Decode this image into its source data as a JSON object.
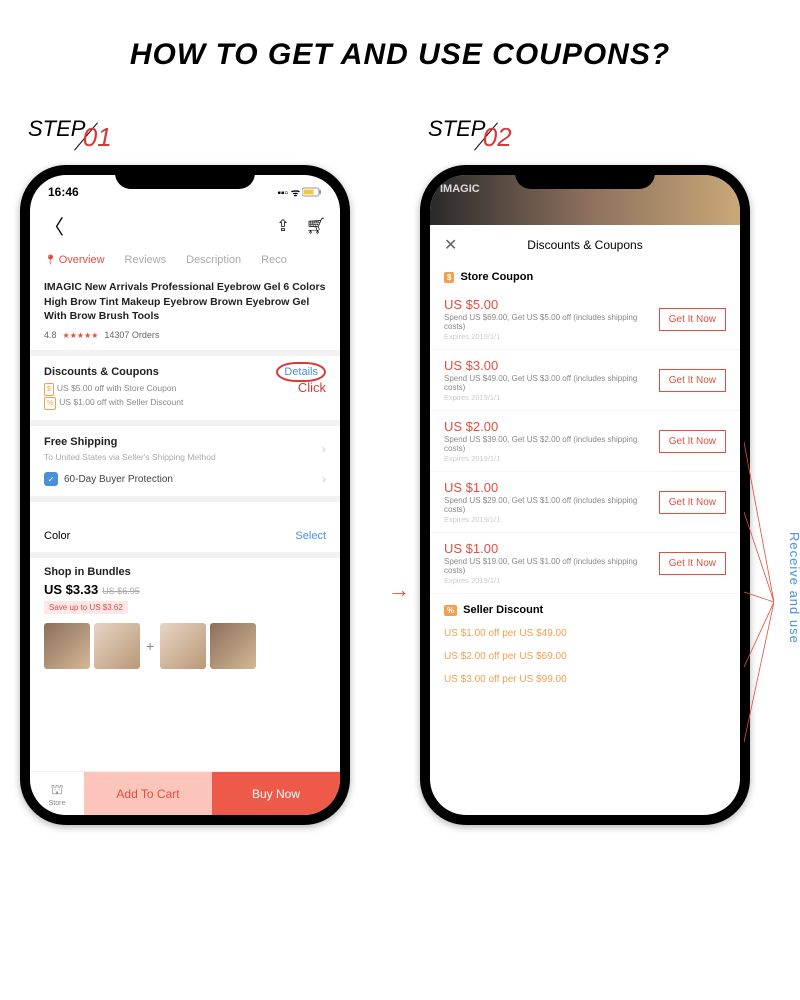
{
  "title": "HOW TO GET AND USE COUPONS?",
  "step1": {
    "label": "STEP",
    "num": "01"
  },
  "step2": {
    "label": "STEP",
    "num": "02"
  },
  "statusbar": {
    "time": "16:46",
    "signal": "▪▪▫ ᯤ"
  },
  "topbar": {
    "back": "〈"
  },
  "tabs": {
    "overview": "Overview",
    "reviews": "Reviews",
    "description": "Description",
    "reco": "Reco"
  },
  "product": {
    "title": "IMAGIC New Arrivals  Professional Eyebrow Gel 6 Colors High Brow Tint Makeup Eyebrow Brown Eyebrow Gel With Brow Brush Tools",
    "rating": "4.8",
    "stars": "★★★★★",
    "orders": "14307 Orders"
  },
  "dc": {
    "title": "Discounts & Coupons",
    "line1": "US $5.00 off with Store Coupon",
    "line2": "US $1.00 off with Seller Discount",
    "details": "Details",
    "click": "Click"
  },
  "fs": {
    "title": "Free Shipping",
    "sub": "To United States via Seller's Shipping Method"
  },
  "bp": {
    "label": "60-Day Buyer Protection"
  },
  "color": {
    "label": "Color",
    "select": "Select"
  },
  "bundle": {
    "title": "Shop in Bundles",
    "price": "US $3.33",
    "old": "US $6.95",
    "save": "Save up to US $3.62"
  },
  "bottombar": {
    "store": "Store",
    "addcart": "Add To Cart",
    "buynow": "Buy Now"
  },
  "phone2": {
    "hero": "IMAGIC",
    "modal_title": "Discounts & Coupons",
    "store_coupon": "Store Coupon",
    "coupons": [
      {
        "amt": "US $5.00",
        "desc": "Spend US $69.00, Get US $5.00 off (includes shipping costs)",
        "exp": "Expires 2019/1/1"
      },
      {
        "amt": "US $3.00",
        "desc": "Spend US $49.00, Get US $3.00 off (includes shipping costs)",
        "exp": "Expires 2019/1/1"
      },
      {
        "amt": "US $2.00",
        "desc": "Spend US $39.00, Get US $2.00 off (includes shipping costs)",
        "exp": "Expires 2019/1/1"
      },
      {
        "amt": "US $1.00",
        "desc": "Spend US $29.00, Get US $1.00 off (includes shipping costs)",
        "exp": "Expires 2019/1/1"
      },
      {
        "amt": "US $1.00",
        "desc": "Spend US $19.00, Get US $1.00 off (includes shipping costs)",
        "exp": "Expires 2019/1/1"
      }
    ],
    "getit": "Get It Now",
    "seller_discount": "Seller Discount",
    "sd_lines": [
      "US $1.00 off per US $49.00",
      "US $2.00 off per US $69.00",
      "US $3.00 off per US $99.00"
    ]
  },
  "arrow": "→",
  "receive_label": "Receive and use"
}
